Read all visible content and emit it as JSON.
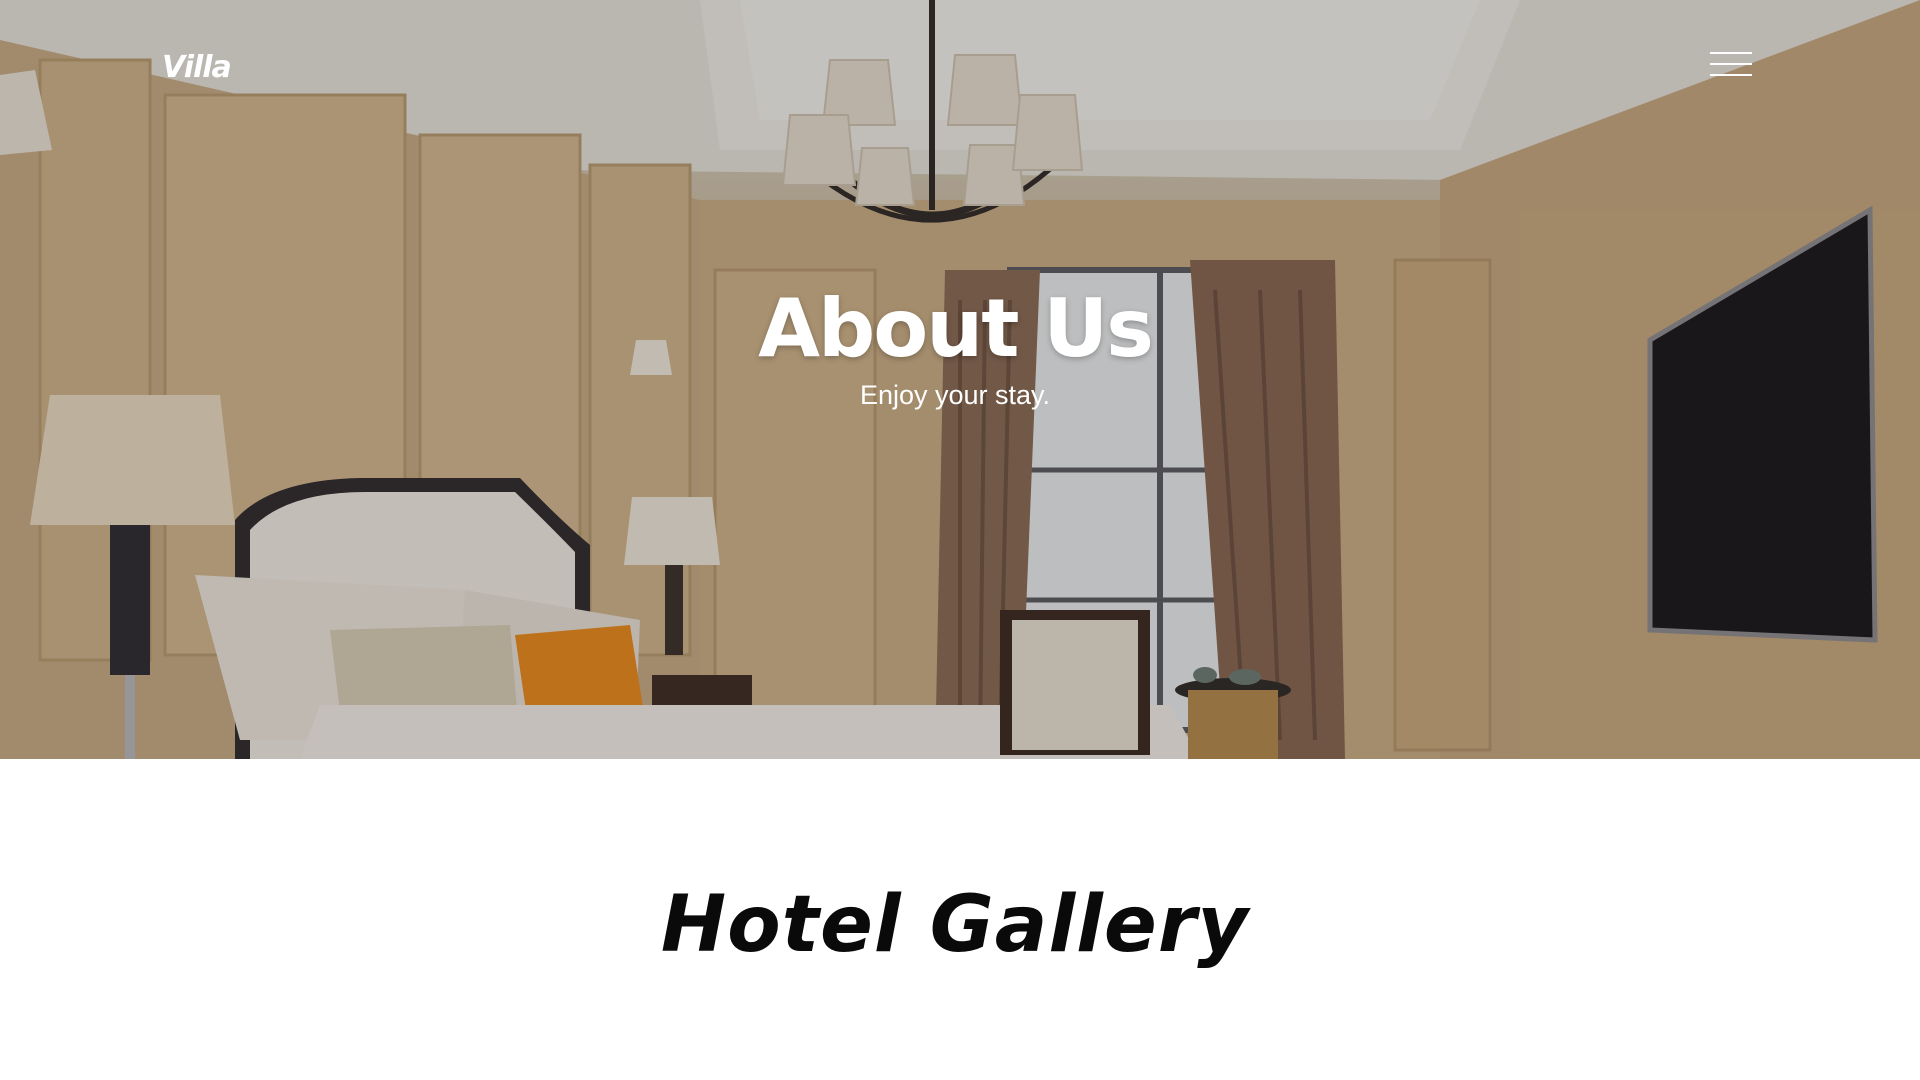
{
  "header": {
    "logo_text": "Villa",
    "menu_icon": "hamburger-menu-icon"
  },
  "hero": {
    "title": "About Us",
    "subtitle": "Enjoy your stay."
  },
  "gallery": {
    "title": "Hotel Gallery"
  },
  "colors": {
    "overlay": "#1e1a16",
    "text_light": "#ffffff",
    "text_dark": "#0a0a0a",
    "accent_pillow": "#e98a1c"
  }
}
